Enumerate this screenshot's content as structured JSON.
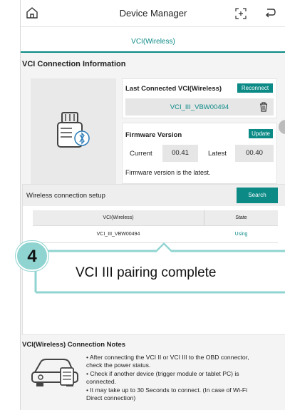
{
  "header": {
    "title": "Device Manager",
    "tab": "VCI(Wireless)"
  },
  "connection_info": {
    "section_title": "VCI Connection Information",
    "last_connected_label": "Last Connected VCI(Wireless)",
    "reconnect_label": "Reconnect",
    "vci_name": "VCI_III_VBW00494",
    "firmware_label": "Firmware Version",
    "update_label": "Update",
    "current_label": "Current",
    "current_value": "00.41",
    "latest_label": "Latest",
    "latest_value": "00.40",
    "firmware_message": "Firmware version is the latest."
  },
  "wireless_setup": {
    "title": "Wireless connection setup",
    "search_label": "Search",
    "columns": [
      "VCI(Wireless)",
      "State"
    ],
    "rows": [
      {
        "vci": "VCI_III_VBW00494",
        "state": "Using"
      }
    ]
  },
  "callout": {
    "step": "4",
    "text": "VCI III pairing complete"
  },
  "notes": {
    "title": "VCI(Wireless) Connection Notes",
    "line1": "• After connecting the VCI II or VCI III to the OBD connector,",
    "line2": "check the power status.",
    "line3": "• Check if another device (trigger module or tablet PC) is",
    "line4": "connected.",
    "line5": "• It may take up to 30 Seconds to connect. (In case of Wi-Fi",
    "line6": "Direct connection)"
  },
  "colors": {
    "accent": "#0b8a86",
    "callout_badge": "#8fd4d0"
  }
}
